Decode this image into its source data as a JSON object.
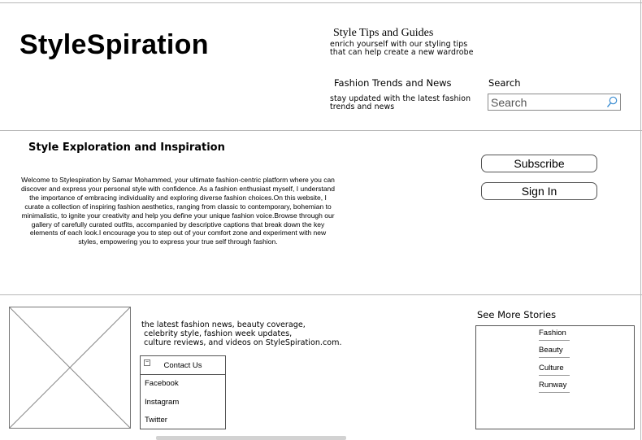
{
  "header": {
    "logo": "StyleSpiration",
    "nav": [
      {
        "title": "Style Tips and Guides",
        "desc_lines": [
          "enrich yourself with our styling tips",
          "that can help create a new wardrobe"
        ]
      },
      {
        "title": "Fashion Trends and News",
        "desc_lines": [
          "stay updated with the latest fashion",
          "trends and news"
        ]
      }
    ],
    "search": {
      "label": "Search",
      "placeholder": "Search",
      "icon": "search-icon"
    }
  },
  "intro": {
    "title": "Style Exploration and Inspiration",
    "body": "Welcome to Stylespiration by Samar Mohammed, your ultimate fashion-centric platform where you can discover and express your personal style with confidence. As a fashion enthusiast myself, I understand the importance of embracing individuality and exploring diverse fashion choices.On this website, I curate a collection of inspiring fashion aesthetics, ranging from classic to contemporary, bohemian to minimalistic, to ignite your creativity and help you define your unique fashion voice.Browse through our gallery of carefully curated outfits, accompanied by descriptive captions that break down the key elements of each look.I encourage you to step out of your comfort zone and experiment with new styles, empowering you to express your true self through fashion."
  },
  "actions": {
    "subscribe": "Subscribe",
    "signin": "Sign In"
  },
  "footer": {
    "blurb_lines": [
      "the latest fashion news, beauty coverage,",
      " celebrity style, fashion week updates,",
      " culture reviews, and videos on StyleSpiration.com."
    ],
    "contact": {
      "title": "Contact Us",
      "links": [
        "Facebook",
        "Instagram",
        "Twitter"
      ]
    },
    "stories": {
      "title": "See More Stories",
      "items": [
        "Fashion",
        "Beauty",
        "Culture",
        "Runway"
      ]
    }
  }
}
